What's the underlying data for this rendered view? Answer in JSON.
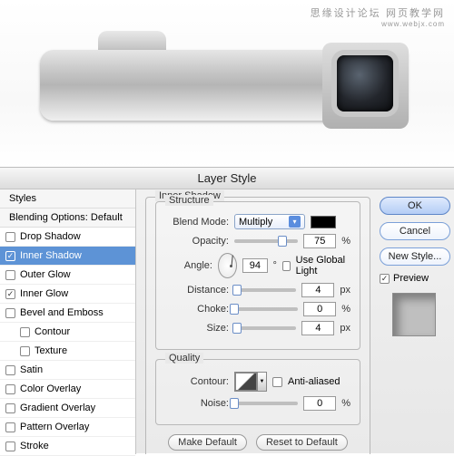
{
  "watermark": {
    "line1": "思缘设计论坛",
    "line2": "网页教学网",
    "line3": "www.webjx.com"
  },
  "dialog": {
    "title": "Layer Style"
  },
  "styles": {
    "header": "Styles",
    "blending": "Blending Options: Default",
    "items": [
      {
        "label": "Drop Shadow",
        "checked": false,
        "active": false
      },
      {
        "label": "Inner Shadow",
        "checked": true,
        "active": true
      },
      {
        "label": "Outer Glow",
        "checked": false,
        "active": false
      },
      {
        "label": "Inner Glow",
        "checked": true,
        "active": false
      },
      {
        "label": "Bevel and Emboss",
        "checked": false,
        "active": false
      },
      {
        "label": "Contour",
        "checked": false,
        "active": false,
        "indent": true
      },
      {
        "label": "Texture",
        "checked": false,
        "active": false,
        "indent": true
      },
      {
        "label": "Satin",
        "checked": false,
        "active": false
      },
      {
        "label": "Color Overlay",
        "checked": false,
        "active": false
      },
      {
        "label": "Gradient Overlay",
        "checked": false,
        "active": false
      },
      {
        "label": "Pattern Overlay",
        "checked": false,
        "active": false
      },
      {
        "label": "Stroke",
        "checked": false,
        "active": false
      }
    ]
  },
  "panel": {
    "title": "Inner Shadow",
    "structure": {
      "legend": "Structure",
      "blend_label": "Blend Mode:",
      "blend_value": "Multiply",
      "opacity_label": "Opacity:",
      "opacity_value": "75",
      "angle_label": "Angle:",
      "angle_value": "94",
      "use_global": "Use Global Light",
      "distance_label": "Distance:",
      "distance_value": "4",
      "choke_label": "Choke:",
      "choke_value": "0",
      "size_label": "Size:",
      "size_value": "4",
      "px": "px",
      "pct": "%",
      "deg": "°"
    },
    "quality": {
      "legend": "Quality",
      "contour_label": "Contour:",
      "antialiased": "Anti-aliased",
      "noise_label": "Noise:",
      "noise_value": "0",
      "pct": "%"
    },
    "make_default": "Make Default",
    "reset_default": "Reset to Default"
  },
  "right": {
    "ok": "OK",
    "cancel": "Cancel",
    "new_style": "New Style...",
    "preview": "Preview"
  },
  "colors": {
    "swatch": "#000000"
  }
}
